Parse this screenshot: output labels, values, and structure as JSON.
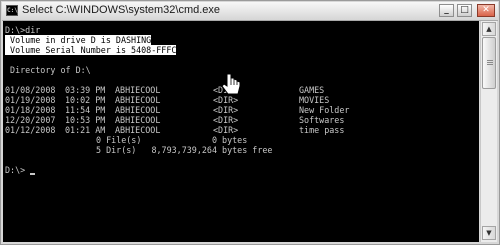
{
  "window": {
    "title": "Select C:\\WINDOWS\\system32\\cmd.exe",
    "icon_glyph": "C:\\",
    "buttons": {
      "minimize": "_",
      "maximize": "□",
      "close": "✕"
    }
  },
  "console": {
    "prompt_command": "D:\\>dir",
    "volume_line": " Volume in drive D is DASHING",
    "serial_line": " Volume Serial Number is 5408-FFFC",
    "directory_of": " Directory of D:\\",
    "entries": [
      {
        "date": "01/08/2008",
        "time": "03:39 PM",
        "owner": "ABHIECOOL",
        "type": "<DIR>",
        "name": "GAMES"
      },
      {
        "date": "01/19/2008",
        "time": "10:02 PM",
        "owner": "ABHIECOOL",
        "type": "<DIR>",
        "name": "MOVIES"
      },
      {
        "date": "01/18/2008",
        "time": "11:54 PM",
        "owner": "ABHIECOOL",
        "type": "<DIR>",
        "name": "New Folder"
      },
      {
        "date": "12/20/2007",
        "time": "10:53 PM",
        "owner": "ABHIECOOL",
        "type": "<DIR>",
        "name": "Softwares"
      },
      {
        "date": "01/12/2008",
        "time": "01:21 AM",
        "owner": "ABHIECOOL",
        "type": "<DIR>",
        "name": "time pass"
      }
    ],
    "files_summary": "0 File(s)              0 bytes",
    "dirs_summary": "5 Dir(s)   8,793,739,264 bytes free",
    "final_prompt": "D:\\>"
  },
  "colors": {
    "console_bg": "#000000",
    "console_text": "#c7c7c7",
    "selection": "#ffffff"
  },
  "icons": {
    "pointer": "hand-pointer-icon"
  }
}
